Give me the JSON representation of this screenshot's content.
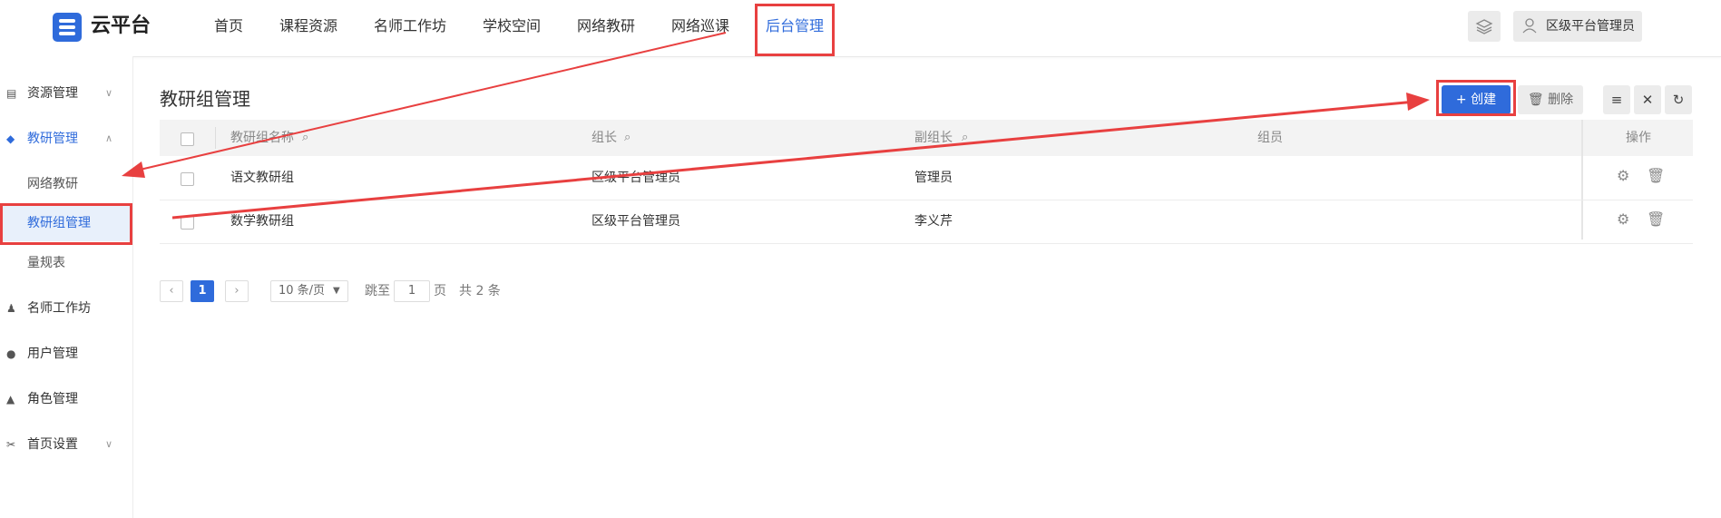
{
  "header": {
    "logo_text": "云平台",
    "nav": [
      "首页",
      "课程资源",
      "名师工作坊",
      "学校空间",
      "网络教研",
      "网络巡课",
      "后台管理"
    ],
    "active_nav": "后台管理",
    "user_name": "区级平台管理员"
  },
  "sidebar": {
    "items": [
      {
        "label": "资源管理",
        "icon": "folder-icon",
        "expanded": false
      },
      {
        "label": "教研管理",
        "icon": "graduation-cap-icon",
        "expanded": true
      },
      {
        "label": "网络教研"
      },
      {
        "label": "教研组管理"
      },
      {
        "label": "量规表"
      },
      {
        "label": "名师工作坊",
        "icon": "users-icon"
      },
      {
        "label": "用户管理",
        "icon": "user-icon"
      },
      {
        "label": "角色管理",
        "icon": "shapes-icon"
      },
      {
        "label": "首页设置",
        "icon": "tools-icon",
        "expanded": false
      }
    ],
    "active_item": "教研组管理"
  },
  "main": {
    "title": "教研组管理",
    "create_label": "+ 创建",
    "delete_label": "删除",
    "columns": [
      "教研组名称",
      "组长",
      "副组长",
      "组员",
      "操作"
    ],
    "rows": [
      {
        "name": "语文教研组",
        "leader": "区级平台管理员",
        "deputy": "管理员",
        "members": ""
      },
      {
        "name": "数学教研组",
        "leader": "区级平台管理员",
        "deputy": "李义芹",
        "members": ""
      }
    ]
  },
  "pagination": {
    "current_page": "1",
    "page_size": "10 条/页",
    "jump_label": "跳至",
    "jump_value": "1",
    "page_unit": "页",
    "total": "共 2 条"
  },
  "colors": {
    "accent": "#2f6bdb",
    "highlight": "#e84040"
  }
}
